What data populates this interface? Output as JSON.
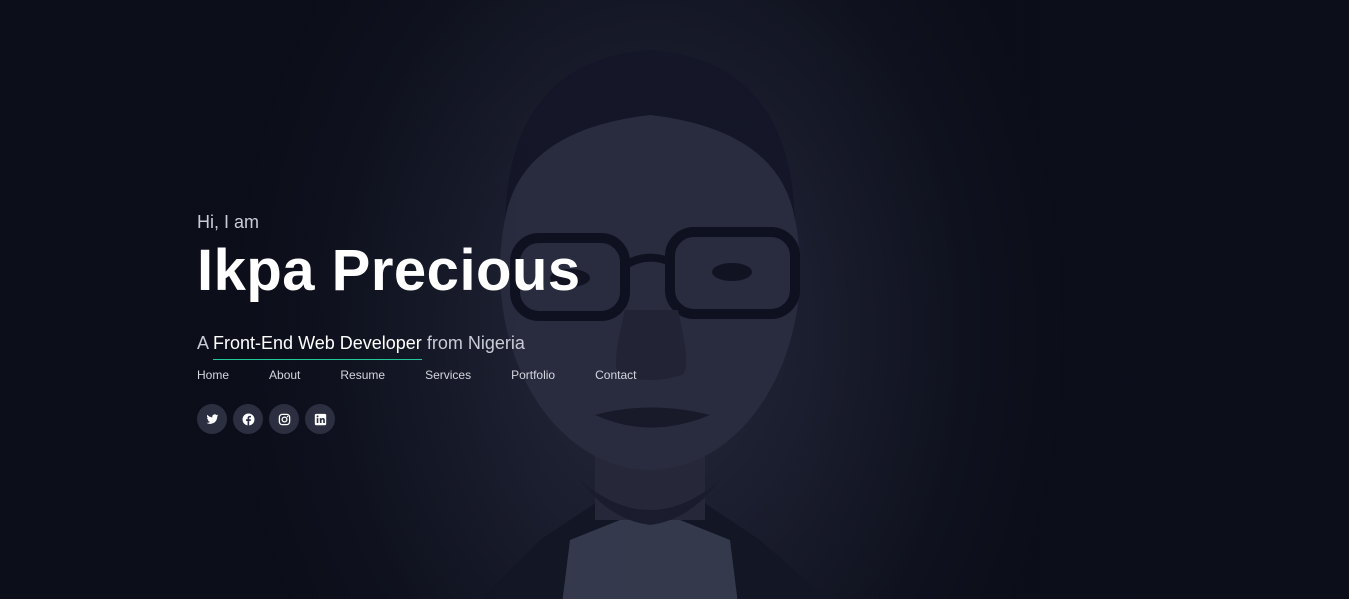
{
  "hero": {
    "greeting": "Hi, I am",
    "name": "Ikpa Precious",
    "tagline": {
      "prefix": "A",
      "role": "Front-End Web Developer",
      "suffix": "from Nigeria"
    }
  },
  "nav": {
    "items": [
      {
        "label": "Home"
      },
      {
        "label": "About"
      },
      {
        "label": "Resume"
      },
      {
        "label": "Services"
      },
      {
        "label": "Portfolio"
      },
      {
        "label": "Contact"
      }
    ]
  },
  "social": [
    {
      "icon": "twitter-icon"
    },
    {
      "icon": "facebook-icon"
    },
    {
      "icon": "instagram-icon"
    },
    {
      "icon": "linkedin-icon"
    }
  ],
  "colors": {
    "background": "#0c0f1c",
    "accent": "#20c997",
    "text": "#ffffff",
    "muted": "#c9ccd6",
    "social_bg": "#2b2f40"
  }
}
